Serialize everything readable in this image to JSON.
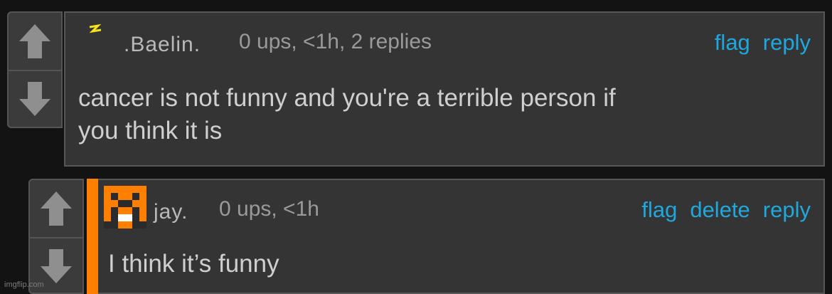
{
  "comments": [
    {
      "username": ".Baelin.",
      "meta": "0 ups, <1h, 2 replies",
      "actions": [
        "flag",
        "reply"
      ],
      "text_lines": [
        "cancer is not funny and you're a terrible person if",
        "you think it is"
      ]
    },
    {
      "username": "jay.",
      "meta": "0 ups, <1h",
      "actions": [
        "flag",
        "delete",
        "reply"
      ],
      "text_lines": [
        "I think it’s funny"
      ]
    }
  ],
  "watermark": "imgflip.com",
  "colors": {
    "background": "#131313",
    "panel": "#343434",
    "link": "#1fa8dd",
    "reply_accent": "#ff7f00",
    "lightning": "#f5e21a"
  },
  "icons": [
    "upvote-arrow-icon",
    "downvote-arrow-icon",
    "lightning-badge-icon",
    "pixel-creeper-avatar-icon"
  ]
}
